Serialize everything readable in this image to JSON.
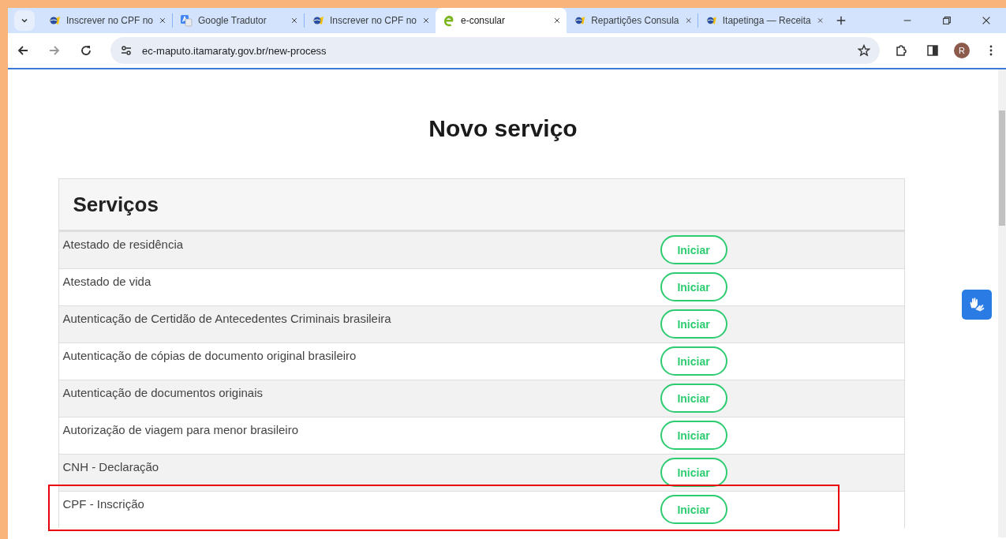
{
  "browser": {
    "tabs": [
      {
        "title": "Inscrever no CPF no",
        "kind": "gov",
        "selected": false
      },
      {
        "title": "Google Tradutor",
        "kind": "translate",
        "selected": false
      },
      {
        "title": "Inscrever no CPF no",
        "kind": "gov",
        "selected": false
      },
      {
        "title": "e-consular",
        "kind": "consular",
        "selected": true
      },
      {
        "title": "Repartições Consula",
        "kind": "gov",
        "selected": false
      },
      {
        "title": "Itapetinga — Receita",
        "kind": "gov",
        "selected": false
      }
    ],
    "address": "ec-maputo.itamaraty.gov.br/new-process",
    "profile_initial": "R"
  },
  "page": {
    "title": "Novo serviço",
    "panel_title": "Serviços",
    "rows": [
      {
        "name": "Atestado de residência",
        "button": "Iniciar",
        "highlighted": false
      },
      {
        "name": "Atestado de vida",
        "button": "Iniciar",
        "highlighted": false
      },
      {
        "name": "Autenticação de Certidão de Antecedentes Criminais brasileira",
        "button": "Iniciar",
        "highlighted": false
      },
      {
        "name": "Autenticação de cópias de documento original brasileiro",
        "button": "Iniciar",
        "highlighted": false
      },
      {
        "name": "Autenticação de documentos originais",
        "button": "Iniciar",
        "highlighted": false
      },
      {
        "name": "Autorização de viagem para menor brasileiro",
        "button": "Iniciar",
        "highlighted": false
      },
      {
        "name": "CNH - Declaração",
        "button": "Iniciar",
        "highlighted": false
      },
      {
        "name": "CPF - Inscrição",
        "button": "Iniciar",
        "highlighted": true
      }
    ]
  }
}
